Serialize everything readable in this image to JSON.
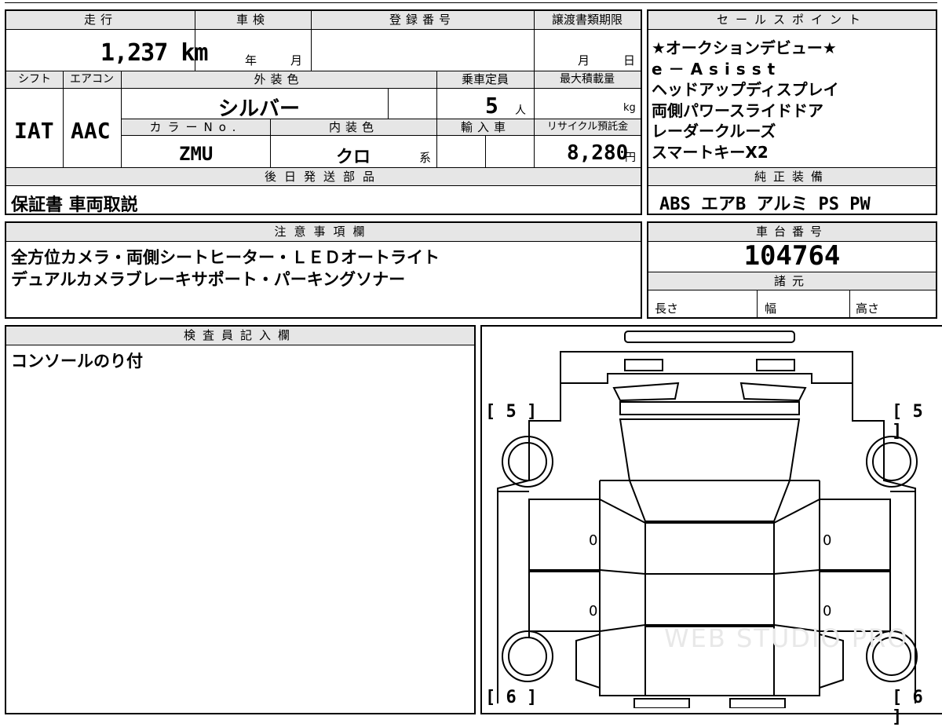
{
  "top": {
    "mileage_label": "走行",
    "mileage_value": "1,237 km",
    "inspection_label": "車検",
    "inspection_year": "年",
    "inspection_month": "月",
    "registration_label": "登録番号",
    "transfer_label": "譲渡書類期限",
    "transfer_month": "月",
    "transfer_day": "日"
  },
  "specs": {
    "shift_label": "シフト",
    "shift_value": "IAT",
    "ac_label": "エアコン",
    "ac_value": "AAC",
    "exterior_label": "外装色",
    "exterior_value": "シルバー",
    "capacity_label": "乗車定員",
    "capacity_value": "5",
    "capacity_unit": "人",
    "max_load_label": "最大積載量",
    "max_load_unit": "kg",
    "color_no_label": "カラーNo.",
    "color_no_value": "ZMU",
    "interior_label": "内装色",
    "interior_value": "クロ",
    "interior_suffix": "系",
    "import_label": "輸入車",
    "recycle_label": "リサイクル預託金",
    "recycle_value": "8,280",
    "recycle_unit": "円"
  },
  "shipping": {
    "label": "後日発送部品",
    "value": "保証書 車両取説"
  },
  "sales_points": {
    "label": "セールスポイント",
    "lines": [
      "★オークションデビュー★",
      "e－Asisst",
      "ヘッドアップディスプレイ",
      "両側パワースライドドア",
      "レーダークルーズ",
      "スマートキーX2"
    ]
  },
  "equipment": {
    "label": "純正装備",
    "value": "ABS エアB アルミ PS PW"
  },
  "notes": {
    "label": "注意事項欄",
    "lines": [
      "全方位カメラ・両側シートヒーター・ＬＥＤオートライト",
      "デュアルカメラブレーキサポート・パーキングソナー"
    ]
  },
  "chassis": {
    "label": "車台番号",
    "value": "104764"
  },
  "dimensions": {
    "label": "諸元",
    "length": "長さ",
    "width": "幅",
    "height": "高さ"
  },
  "inspector": {
    "label": "検査員記入欄",
    "value": "コンソールのり付"
  },
  "diagram": {
    "tire_front_left": "[ 5 ]",
    "tire_front_right": "[ 5 ]",
    "tire_rear_left": "[ 6 ]",
    "tire_rear_right": "[ 6 ]",
    "door_marks": [
      "0",
      "0",
      "0",
      "0"
    ],
    "watermark": "WEB STUDIO PRO"
  }
}
